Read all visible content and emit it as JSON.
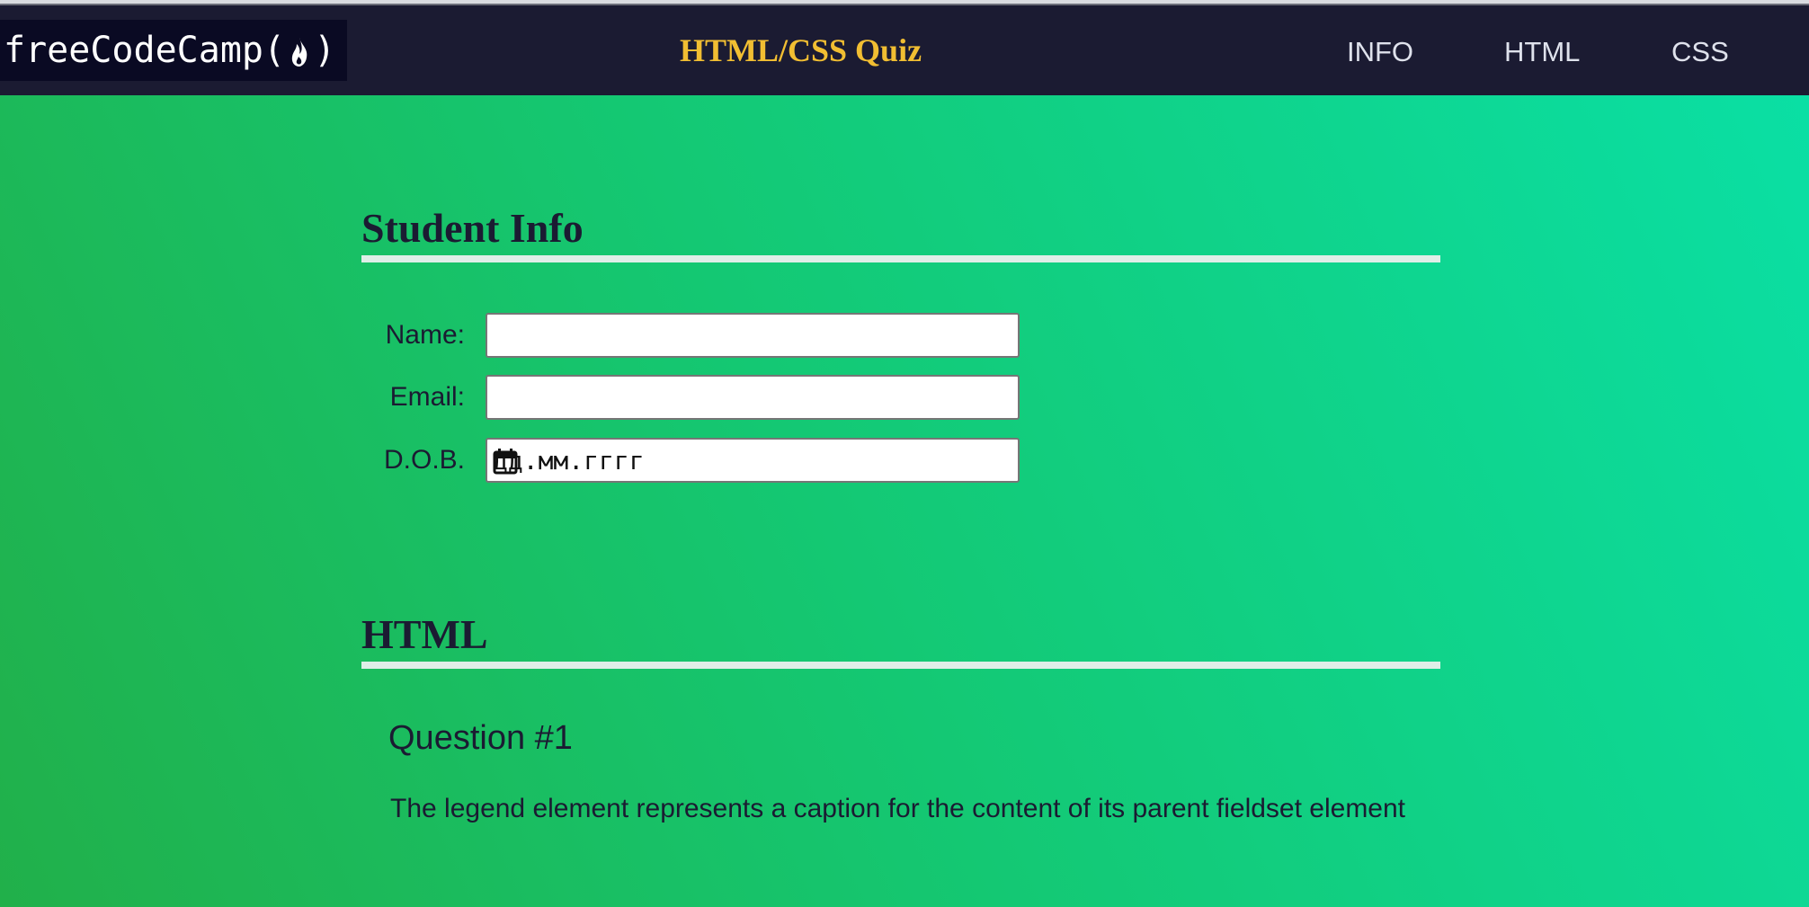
{
  "header": {
    "logo_text_left": "freeCodeCamp(",
    "logo_text_right": ")",
    "logo_icon": "flame-icon",
    "title": "HTML/CSS Quiz",
    "nav": [
      {
        "label": "INFO"
      },
      {
        "label": "HTML"
      },
      {
        "label": "CSS"
      }
    ]
  },
  "student_info": {
    "heading": "Student Info",
    "fields": [
      {
        "label": "Name:",
        "value": ""
      },
      {
        "label": "Email:",
        "value": ""
      },
      {
        "label": "D.O.B.",
        "placeholder": "дд.мм.гггг",
        "icon": "calendar-icon"
      }
    ]
  },
  "html_section": {
    "heading": "HTML",
    "question": {
      "title": "Question #1",
      "text": "The legend element represents a caption for the content of its parent fieldset element"
    }
  },
  "colors": {
    "header_bg": "#1b1b32",
    "logo_bg": "#0a0a23",
    "title_color": "#f1be32",
    "nav_text": "#dfe2ec",
    "gradient_start": "#21b04a",
    "gradient_end": "#0ae0a6"
  }
}
